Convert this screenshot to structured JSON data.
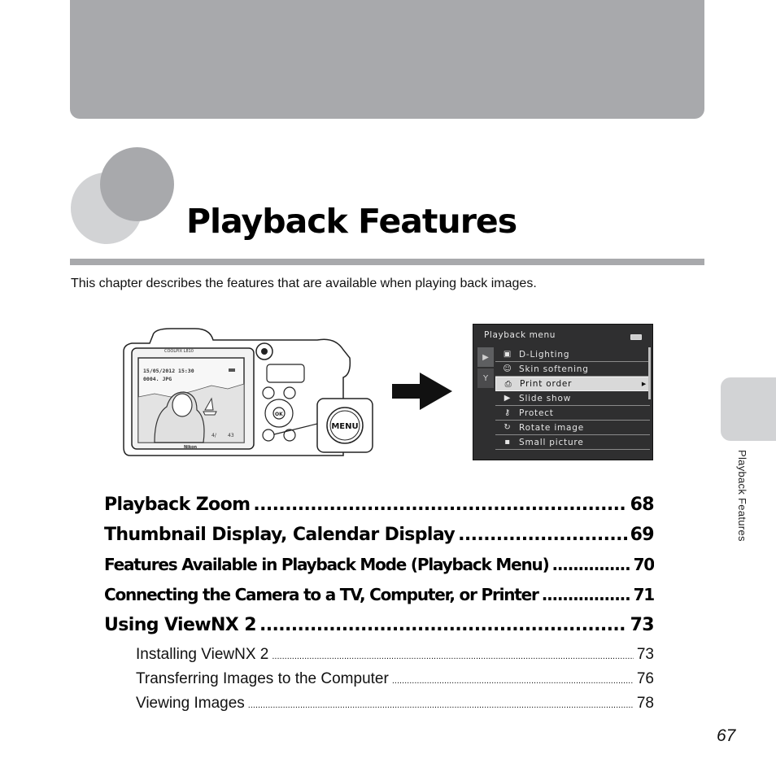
{
  "chapter": {
    "title": "Playback Features",
    "intro": "This chapter describes the features that are available when playing back images."
  },
  "camera": {
    "model": "COOLPIX L810",
    "brand": "Nikon",
    "screen_date": "15/05/2012 15:30",
    "screen_file": "0004. JPG",
    "screen_counter_left": "4/",
    "screen_counter_right": "43",
    "button_label": "MENU",
    "ok_label": "OK"
  },
  "playback_menu": {
    "header": "Playback menu",
    "tabs": [
      {
        "icon": "playback-tab-icon",
        "glyph": "▶"
      },
      {
        "icon": "setup-wrench-icon",
        "glyph": "Y"
      }
    ],
    "items": [
      {
        "label": "D-Lighting",
        "icon": "d-lighting-icon",
        "glyph": "▣",
        "selected": false
      },
      {
        "label": "Skin softening",
        "icon": "skin-softening-icon",
        "glyph": "☺",
        "selected": false
      },
      {
        "label": "Print order",
        "icon": "print-order-icon",
        "glyph": "⎙",
        "selected": true
      },
      {
        "label": "Slide show",
        "icon": "slide-show-icon",
        "glyph": "▶",
        "selected": false
      },
      {
        "label": "Protect",
        "icon": "protect-key-icon",
        "glyph": "⚷",
        "selected": false
      },
      {
        "label": "Rotate image",
        "icon": "rotate-image-icon",
        "glyph": "↻",
        "selected": false
      },
      {
        "label": "Small picture",
        "icon": "small-picture-icon",
        "glyph": "▪",
        "selected": false
      }
    ],
    "selected_arrow": "▶"
  },
  "toc": {
    "main": [
      {
        "label": "Playback Zoom",
        "page": "68"
      },
      {
        "label": "Thumbnail Display, Calendar Display",
        "page": "69"
      },
      {
        "label": "Features Available in Playback Mode (Playback Menu)",
        "page": "70"
      },
      {
        "label": "Connecting the Camera to a TV, Computer, or Printer",
        "page": "71"
      },
      {
        "label": "Using ViewNX 2",
        "page": "73"
      }
    ],
    "sub": [
      {
        "label": "Installing ViewNX 2",
        "page": "73"
      },
      {
        "label": "Transferring Images to the Computer",
        "page": "76"
      },
      {
        "label": "Viewing Images",
        "page": "78"
      }
    ]
  },
  "side_tab_label": "Playback Features",
  "page_number": "67",
  "colors": {
    "band_gray": "#a8a9ac",
    "light_gray": "#d2d3d5",
    "menu_bg": "#2f2f30"
  }
}
